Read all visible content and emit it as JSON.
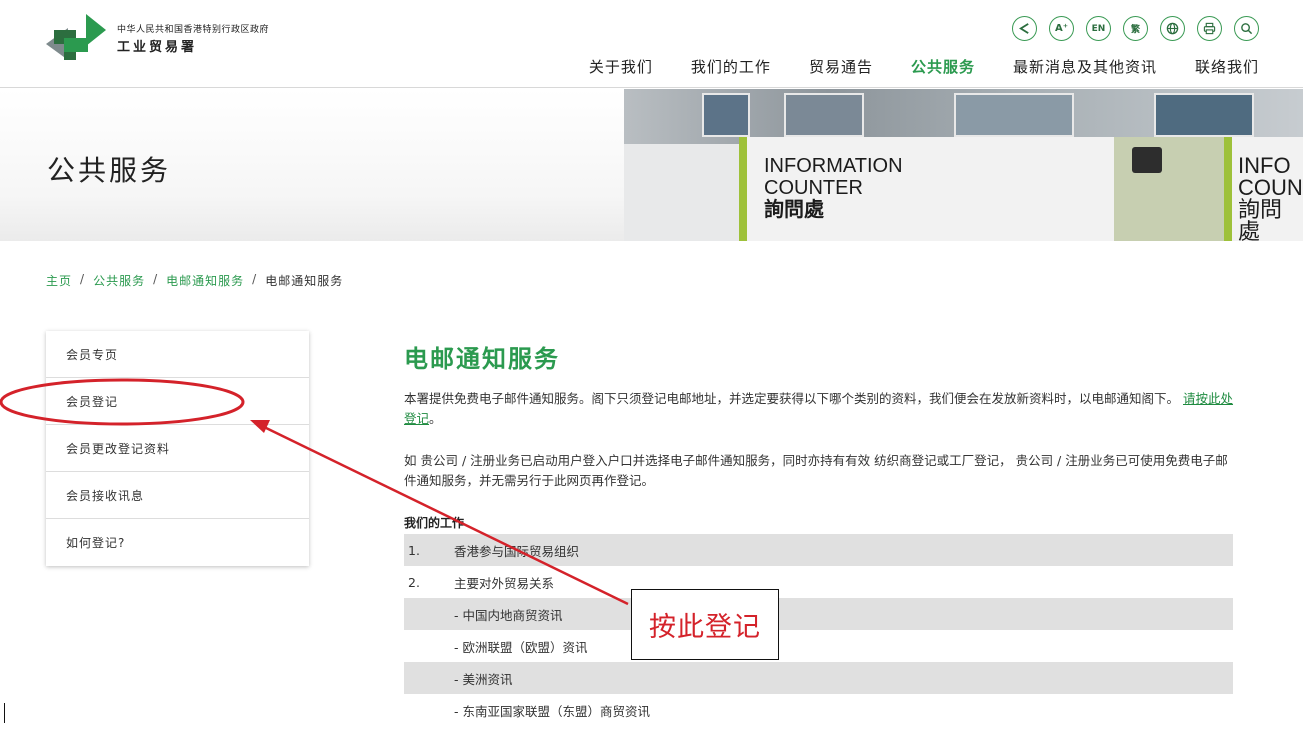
{
  "header": {
    "logo_line1": "中华人民共和国香港特别行政区政府",
    "logo_line2": "工业贸易署",
    "tools": [
      {
        "icon": "share-icon",
        "label": ""
      },
      {
        "icon": "font-size-icon",
        "label": "A⁺"
      },
      {
        "icon": "english-icon",
        "label": "EN"
      },
      {
        "icon": "traditional-chinese-icon",
        "label": "繁"
      },
      {
        "icon": "globe-icon",
        "label": ""
      },
      {
        "icon": "print-icon",
        "label": ""
      },
      {
        "icon": "search-icon",
        "label": ""
      }
    ],
    "nav": [
      {
        "label": "关于我们",
        "active": false
      },
      {
        "label": "我们的工作",
        "active": false
      },
      {
        "label": "贸易通告",
        "active": false
      },
      {
        "label": "公共服务",
        "active": true
      },
      {
        "label": "最新消息及其他资讯",
        "active": false
      },
      {
        "label": "联络我们",
        "active": false
      }
    ],
    "accent_color": "#2b9a4f"
  },
  "banner": {
    "title": "公共服务",
    "photo_sign_1": [
      "INFORMATION",
      "COUNTER",
      "詢問處"
    ],
    "photo_sign_2": [
      "INFO",
      "COUN",
      "詢問處"
    ]
  },
  "breadcrumb": {
    "items": [
      "主页",
      "公共服务",
      "电邮通知服务"
    ],
    "current": "电邮通知服务",
    "separator": "/"
  },
  "sidebar": {
    "items": [
      "会员专页",
      "会员登记",
      "会员更改登记资料",
      "会员接收讯息",
      "如何登记?"
    ]
  },
  "main": {
    "title": "电邮通知服务",
    "para1_text": "本署提供免费电子邮件通知服务。阁下只须登记电邮地址，并选定要获得以下哪个类别的资料，我们便会在发放新资料时，以电邮通知阁下。",
    "para1_link": "请按此处登记",
    "para1_end": "。",
    "para2": "如 贵公司 / 注册业务已启动用户登入户口并选择电子邮件通知服务，同时亦持有有效 纺织商登记或工厂登记， 贵公司 / 注册业务已可使用免费电子邮件通知服务，并无需另行于此网页再作登记。",
    "work_heading": "我们的工作",
    "rows": [
      {
        "num": "1.",
        "text": "香港参与国际贸易组织",
        "sub": false
      },
      {
        "num": "2.",
        "text": "主要对外贸易关系",
        "sub": false
      },
      {
        "num": "",
        "text": "- 中国内地商贸资讯",
        "sub": true
      },
      {
        "num": "",
        "text": "- 欧洲联盟（欧盟）资讯",
        "sub": true
      },
      {
        "num": "",
        "text": "- 美洲资讯",
        "sub": true
      },
      {
        "num": "",
        "text": "- 东南亚国家联盟（东盟）商贸资讯",
        "sub": true
      }
    ]
  },
  "annotation": {
    "callout_text": "按此登记",
    "color": "#d4222a"
  }
}
